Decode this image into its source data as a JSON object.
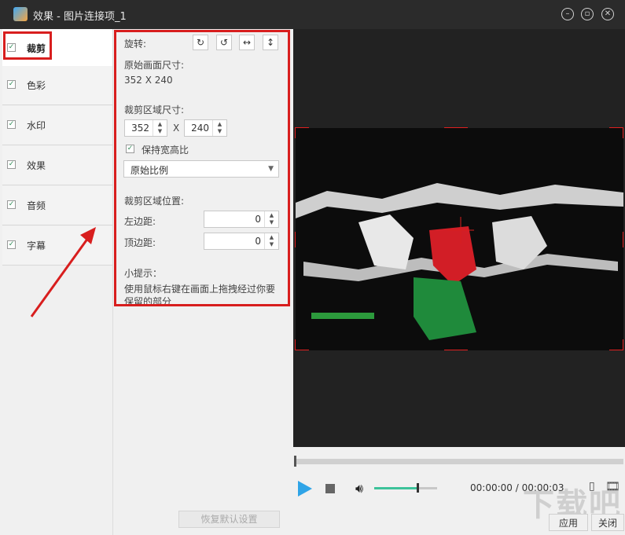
{
  "window": {
    "title": "效果 - 图片连接项_1"
  },
  "sidebar": {
    "items": [
      {
        "label": "裁剪",
        "checked": true,
        "active": true
      },
      {
        "label": "色彩",
        "checked": true,
        "active": false
      },
      {
        "label": "水印",
        "checked": true,
        "active": false
      },
      {
        "label": "效果",
        "checked": true,
        "active": false
      },
      {
        "label": "音频",
        "checked": true,
        "active": false
      },
      {
        "label": "字幕",
        "checked": true,
        "active": false
      }
    ]
  },
  "crop": {
    "rotate_label": "旋转:",
    "rotate_buttons": [
      "↻",
      "↺",
      "↔",
      "↕"
    ],
    "original_size_label": "原始画面尺寸:",
    "original_size_value": "352 X 240",
    "crop_size_label": "裁剪区域尺寸:",
    "width_value": "352",
    "height_value": "240",
    "x_sep": "X",
    "keep_ratio_label": "保持宽高比",
    "keep_ratio_checked": true,
    "ratio_select": "原始比例",
    "position_label": "裁剪区域位置:",
    "left_margin_label": "左边距:",
    "left_margin_value": "0",
    "top_margin_label": "顶边距:",
    "top_margin_value": "0",
    "tip_title": "小提示：",
    "tip_text": "使用鼠标右键在画面上拖拽经过你要保留的部分",
    "reset_button": "恢复默认设置"
  },
  "player": {
    "time_display": "00:00:00 / 00:00:03",
    "volume_level": 0.7,
    "progress": 0.0
  },
  "footer": {
    "apply_button": "应用",
    "close_button": "关闭"
  },
  "colors": {
    "highlight": "#d81e1e",
    "play": "#2fa4e7",
    "volume": "#3cc29a"
  }
}
